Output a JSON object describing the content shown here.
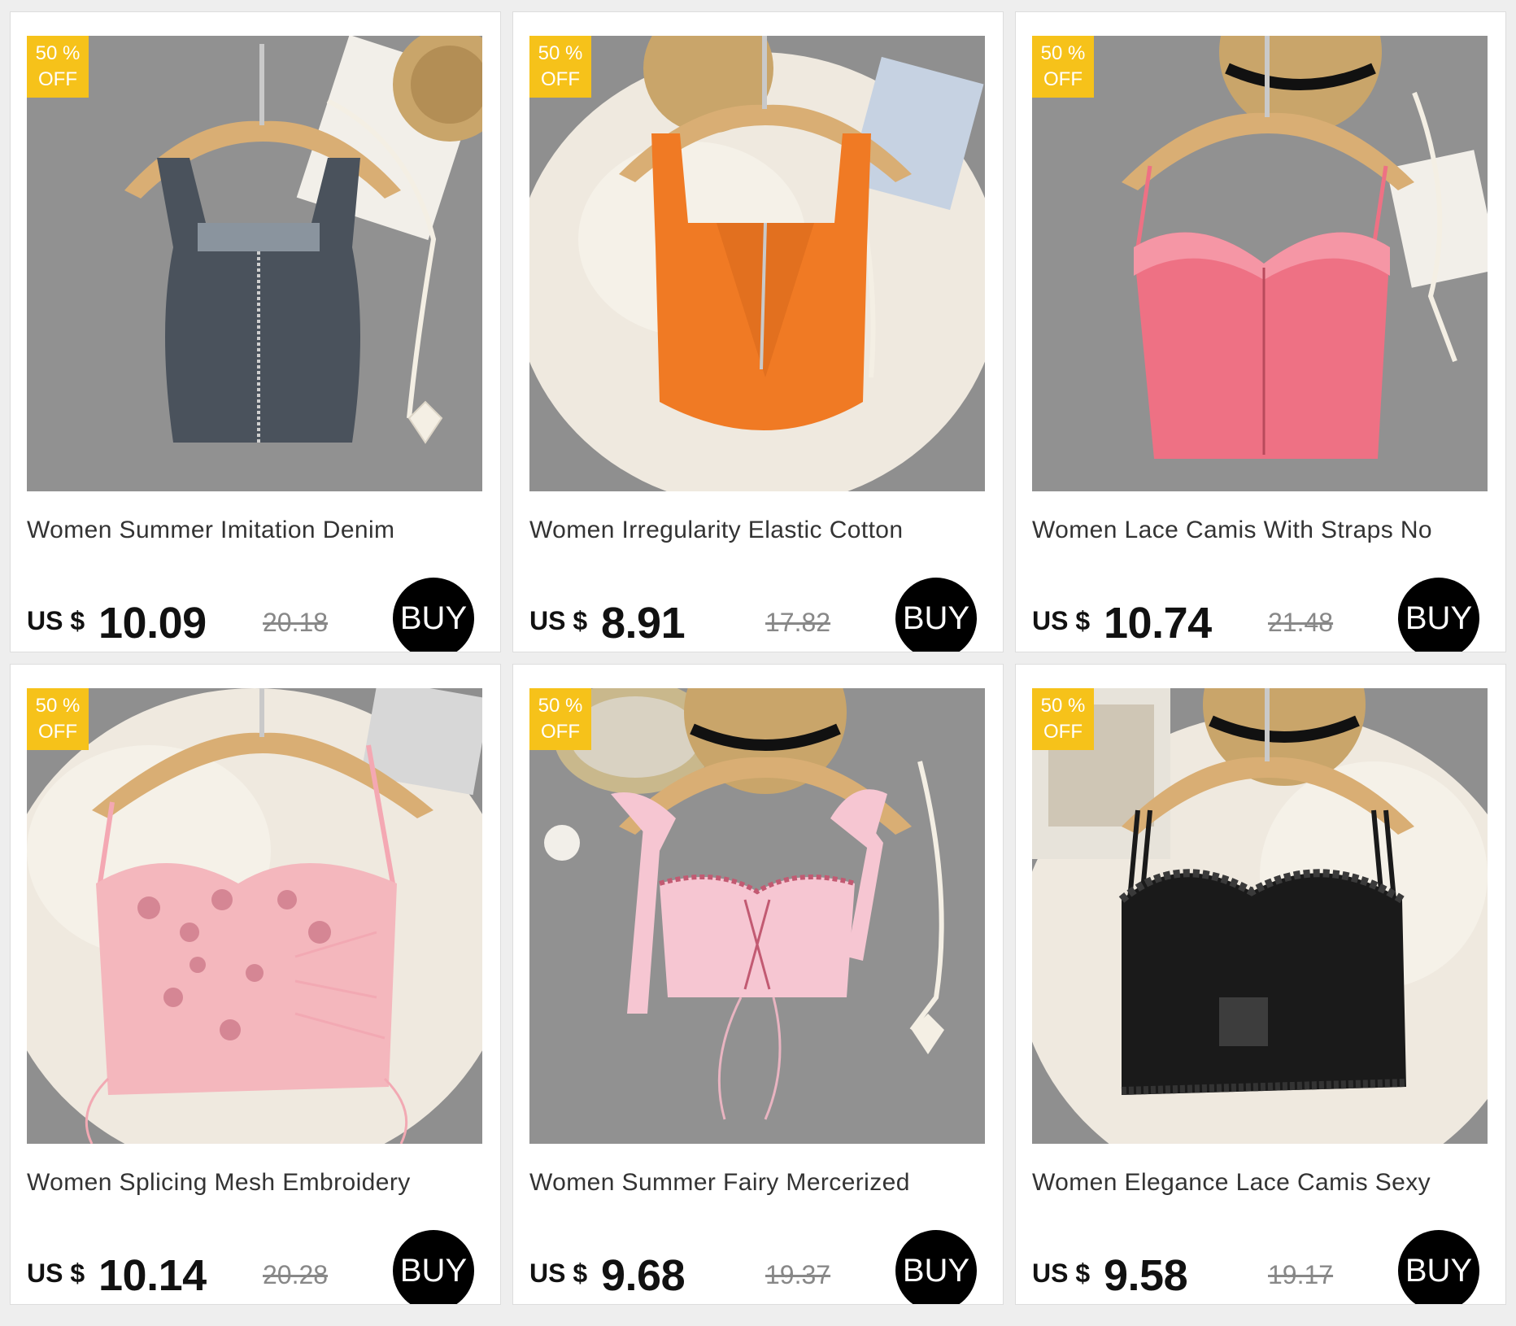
{
  "products": [
    {
      "badge_percent": "50 %",
      "badge_off": "OFF",
      "title": "Women Summer Imitation Denim",
      "currency": "US $",
      "price": "10.09",
      "old_price": "20.18",
      "buy_label": "BUY",
      "background": "gray-carpet",
      "garment_color": "#4a525c"
    },
    {
      "badge_percent": "50 %",
      "badge_off": "OFF",
      "title": "Women Irregularity Elastic Cotton",
      "currency": "US $",
      "price": "8.91",
      "old_price": "17.82",
      "buy_label": "BUY",
      "background": "white-fur",
      "garment_color": "#f07a24"
    },
    {
      "badge_percent": "50 %",
      "badge_off": "OFF",
      "title": "Women Lace Camis With Straps No",
      "currency": "US $",
      "price": "10.74",
      "old_price": "21.48",
      "buy_label": "BUY",
      "background": "gray-carpet",
      "garment_color": "#ee7184"
    },
    {
      "badge_percent": "50 %",
      "badge_off": "OFF",
      "title": "Women Splicing Mesh Embroidery",
      "currency": "US $",
      "price": "10.14",
      "old_price": "20.28",
      "buy_label": "BUY",
      "background": "white-fur",
      "garment_color": "#f4b7bd"
    },
    {
      "badge_percent": "50 %",
      "badge_off": "OFF",
      "title": "Women Summer Fairy Mercerized",
      "currency": "US $",
      "price": "9.68",
      "old_price": "19.37",
      "buy_label": "BUY",
      "background": "gray-carpet",
      "garment_color": "#f6c6d2"
    },
    {
      "badge_percent": "50 %",
      "badge_off": "OFF",
      "title": "Women Elegance Lace Camis Sexy",
      "currency": "US $",
      "price": "9.58",
      "old_price": "19.17",
      "buy_label": "BUY",
      "background": "white-fur",
      "garment_color": "#1a1a1a"
    }
  ],
  "colors": {
    "badge": "#f6c21a",
    "buy_button": "#000000",
    "page_background": "#eeeeee",
    "gray_carpet": "#8f8f8f",
    "white_fur": "#efe9df",
    "hanger": "#d9ae74"
  }
}
